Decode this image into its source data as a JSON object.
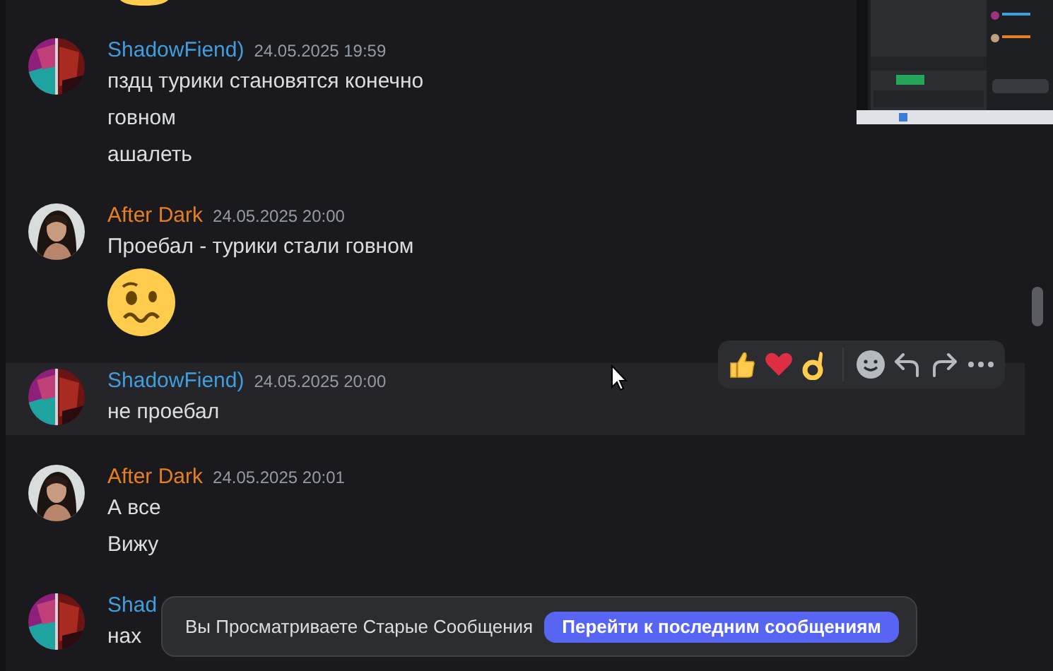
{
  "groups": [
    {
      "author": "ShadowFiend)",
      "color": "#3f9ede",
      "time": "24.05.2025 19:59",
      "hovered": false,
      "lines": [
        {
          "kind": "text",
          "text": "пздц турики становятся конечно"
        },
        {
          "kind": "text",
          "text": "говном"
        },
        {
          "kind": "text",
          "text": "ашалеть"
        }
      ]
    },
    {
      "author": "After Dark",
      "color": "#e67e22",
      "time": "24.05.2025 20:00",
      "hovered": false,
      "lines": [
        {
          "kind": "text",
          "text": "Проебал - турики стали говном"
        },
        {
          "kind": "emoji"
        }
      ]
    },
    {
      "author": "ShadowFiend)",
      "color": "#3f9ede",
      "time": "24.05.2025 20:00",
      "hovered": true,
      "lines": [
        {
          "kind": "text",
          "text": "не проебал"
        }
      ]
    },
    {
      "author": "After Dark",
      "color": "#e67e22",
      "time": "24.05.2025 20:01",
      "hovered": false,
      "lines": [
        {
          "kind": "text",
          "text": "А все"
        },
        {
          "kind": "text",
          "text": "Вижу"
        }
      ]
    },
    {
      "author": "Shad",
      "color": "#3f9ede",
      "hovered": false,
      "lines": [
        {
          "kind": "text",
          "text": "нах"
        }
      ]
    }
  ],
  "notice": {
    "text": "Вы Просматриваете Старые Сообщения",
    "button": "Перейти к последним сообщениям"
  }
}
